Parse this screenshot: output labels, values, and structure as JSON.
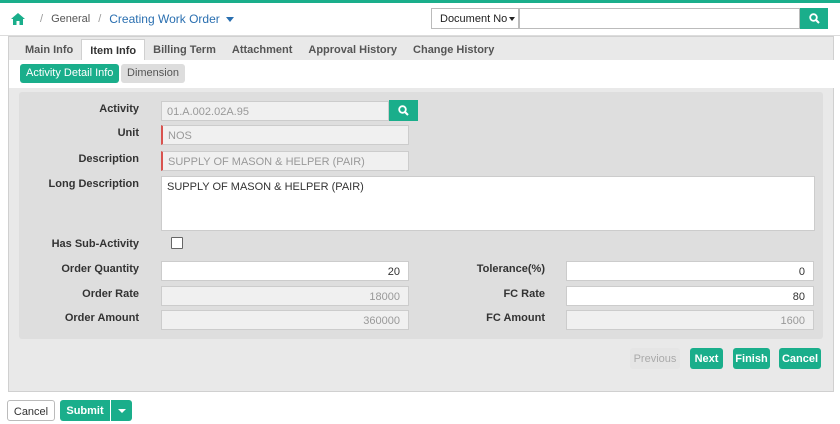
{
  "breadcrumb": {
    "section": "General",
    "current": "Creating Work Order"
  },
  "doc_search": {
    "selector": "Document No",
    "value": ""
  },
  "tabs": [
    "Main Info",
    "Item Info",
    "Billing Term",
    "Attachment",
    "Approval History",
    "Change History"
  ],
  "subtabs": {
    "active": "Activity Detail Info",
    "other": "Dimension"
  },
  "form": {
    "activity": {
      "label": "Activity",
      "value": "01.A.002.02A.95"
    },
    "unit": {
      "label": "Unit",
      "value": "NOS"
    },
    "description": {
      "label": "Description",
      "value": "SUPPLY OF MASON & HELPER (PAIR)"
    },
    "long_description": {
      "label": "Long Description",
      "value": "SUPPLY OF MASON & HELPER (PAIR)"
    },
    "has_sub_activity": {
      "label": "Has Sub-Activity",
      "checked": false
    },
    "order_quantity": {
      "label": "Order Quantity",
      "value": "20"
    },
    "order_rate": {
      "label": "Order Rate",
      "value": "18000"
    },
    "order_amount": {
      "label": "Order Amount",
      "value": "360000"
    },
    "tolerance": {
      "label": "Tolerance(%)",
      "value": "0"
    },
    "fc_rate": {
      "label": "FC Rate",
      "value": "80"
    },
    "fc_amount": {
      "label": "FC Amount",
      "value": "1600"
    }
  },
  "nav_buttons": {
    "previous": "Previous",
    "next": "Next",
    "finish": "Finish",
    "cancel": "Cancel"
  },
  "footer": {
    "cancel": "Cancel",
    "submit": "Submit"
  },
  "colors": {
    "accent": "#1aae8b",
    "link": "#2a6fb0",
    "required": "#d9534f"
  }
}
